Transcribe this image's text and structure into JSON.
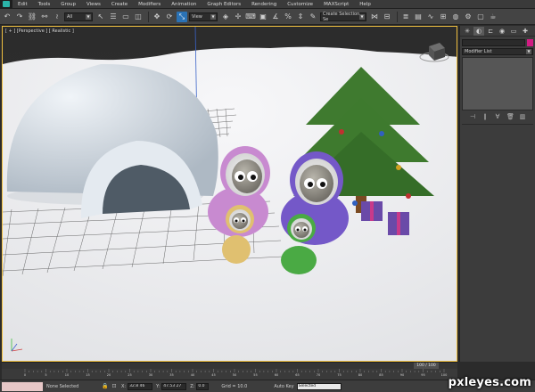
{
  "menu": {
    "items": [
      "Edit",
      "Tools",
      "Group",
      "Views",
      "Create",
      "Modifiers",
      "Animation",
      "Graph Editors",
      "Rendering",
      "Customize",
      "MAXScript",
      "Help"
    ]
  },
  "toolbar": {
    "filter_select": "All",
    "refcoord_select": "View",
    "selection_set": "Create Selection Se"
  },
  "viewport": {
    "label": "[ + ] [Perspective ] [ Realistic ]"
  },
  "command_panel": {
    "modifier_list": "Modifier List"
  },
  "timeline": {
    "frame_readout": "100 / 100",
    "ticks": [
      "0",
      "5",
      "10",
      "15",
      "20",
      "25",
      "30",
      "35",
      "40",
      "45",
      "50",
      "55",
      "60",
      "65",
      "70",
      "75",
      "80",
      "85",
      "90",
      "95",
      "100"
    ]
  },
  "status": {
    "selection": "None Selected",
    "x_label": "X:",
    "x_value": "32.8 46",
    "y_label": "Y:",
    "y_value": "47.53 27",
    "z_label": "Z:",
    "z_value": "0.0",
    "grid": "Grid = 10.0",
    "autokey": "Auto Key",
    "key_select": "Selected"
  },
  "watermark": "pxleyes.com",
  "colors": {
    "accent_blue": "#2a72b5",
    "viewport_border": "#f0c040",
    "object_color": "#d21c83"
  }
}
